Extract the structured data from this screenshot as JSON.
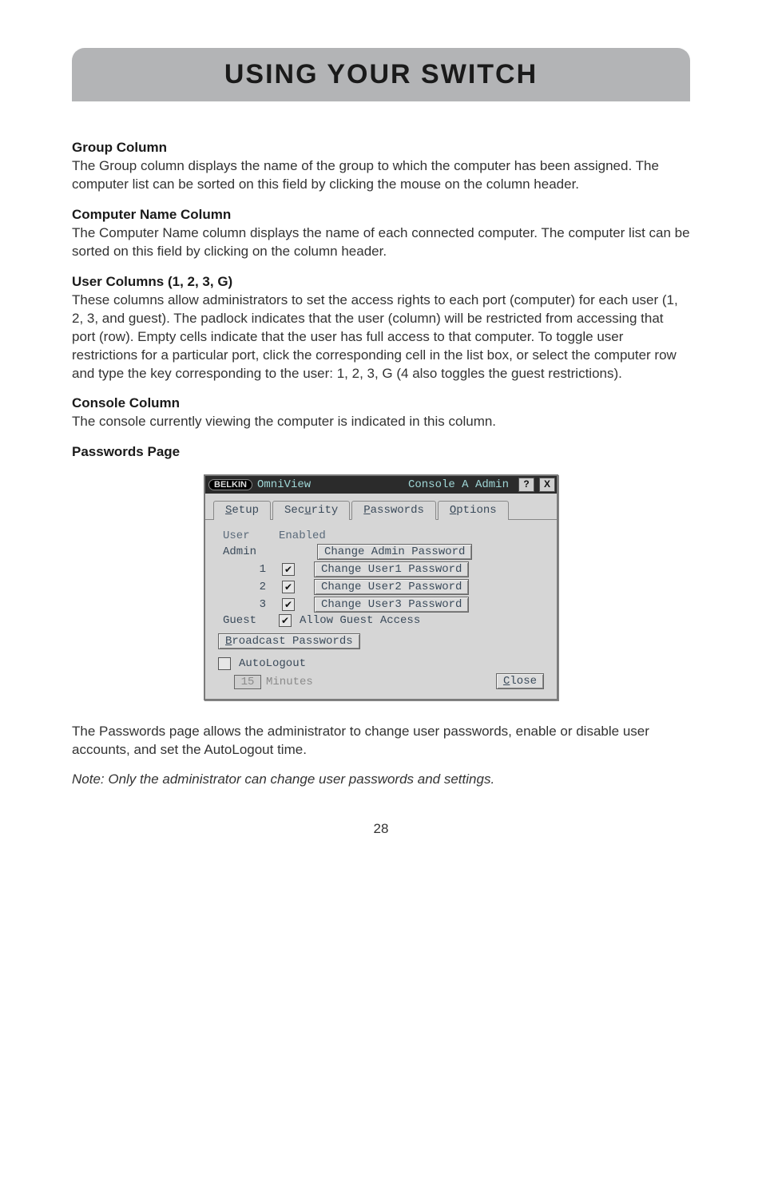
{
  "banner": {
    "title": "USING YOUR SWITCH"
  },
  "sections": {
    "group": {
      "title": "Group Column",
      "text": "The Group column displays the name of the group to which the computer has been assigned. The computer list can be sorted on this field by clicking the mouse on the column header."
    },
    "computer": {
      "title": "Computer Name Column",
      "text": "The Computer Name column displays the name of each connected computer. The computer list can be sorted on this field by clicking on the column header."
    },
    "usercols": {
      "title": "User Columns (1, 2, 3, G)",
      "text": "These columns allow administrators to set the access rights to each port (computer) for each user (1, 2, 3, and guest). The padlock indicates that the user (column) will be restricted from accessing that port (row). Empty cells indicate that the user has full access to that computer. To toggle user restrictions for a particular port, click the corresponding cell in the list box, or select the computer row and type the key corresponding to the user: 1, 2, 3, G (4 also toggles the guest restrictions)."
    },
    "console": {
      "title": "Console Column",
      "text": "The console currently viewing the computer is indicated in this column."
    },
    "passwords_heading": "Passwords Page",
    "passthru_text": "The Passwords page allows the administrator to change user passwords, enable or disable user accounts, and set the AutoLogout time.",
    "note": "Note: Only the administrator can change user passwords and settings."
  },
  "dialog": {
    "logo": "BELKIN",
    "product": "OmniView",
    "console_label": "Console A Admin",
    "help_btn": "?",
    "close_x": "X",
    "tabs": {
      "setup": "Setup",
      "security": "Security",
      "passwords": "Passwords",
      "options": "Options"
    },
    "headers": {
      "user": "User",
      "enabled": "Enabled"
    },
    "rows": {
      "admin": {
        "label": "Admin",
        "btn": "Change Admin Password"
      },
      "u1": {
        "label": "1",
        "btn": "Change User1 Password"
      },
      "u2": {
        "label": "2",
        "btn": "Change User2 Password"
      },
      "u3": {
        "label": "3",
        "btn": "Change User3 Password"
      },
      "guest": {
        "label": "Guest",
        "allow": "Allow Guest Access"
      }
    },
    "broadcast_btn": "Broadcast Passwords",
    "autologout": {
      "label": "AutoLogout",
      "value": "15",
      "unit": "Minutes"
    },
    "close_btn": "Close"
  },
  "page_number": "28"
}
